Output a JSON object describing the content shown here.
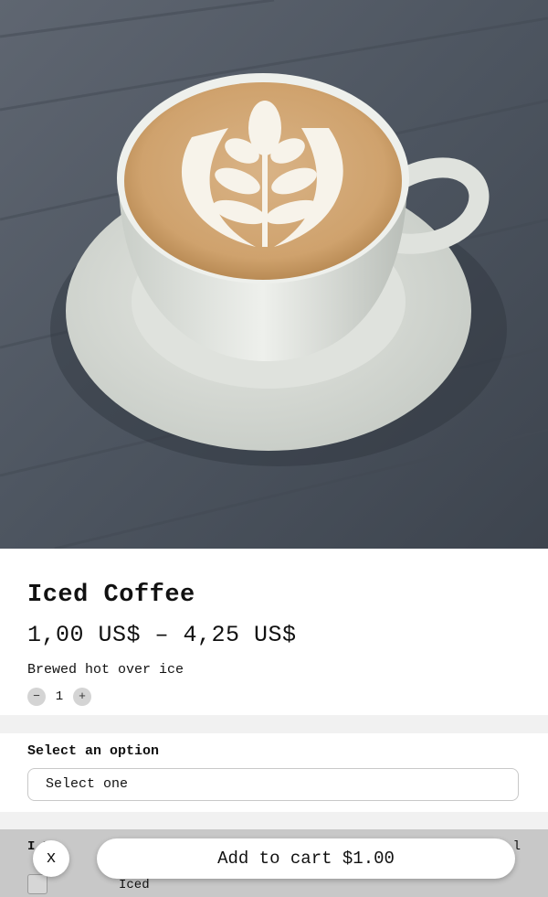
{
  "product": {
    "image_alt": "Latte art coffee cup on saucer",
    "title": "Iced Coffee",
    "price_range": "1,00 US$ – 4,25 US$",
    "description": "Brewed hot over ice",
    "quantity": {
      "minus_label": "−",
      "value": "1",
      "plus_label": "+"
    }
  },
  "option": {
    "label": "Select an option",
    "select_value": "Select one"
  },
  "addons": {
    "header_label": "I  It",
    "header_total": "l",
    "items": [
      {
        "label": "Iced",
        "checked": false
      }
    ]
  },
  "footer": {
    "close_label": "x",
    "add_to_cart_label": "Add to cart $1.00"
  },
  "colors": {
    "table": "#4f5661",
    "section_gap": "#f1f1f1",
    "footer_overlay": "#c8c8c8"
  }
}
